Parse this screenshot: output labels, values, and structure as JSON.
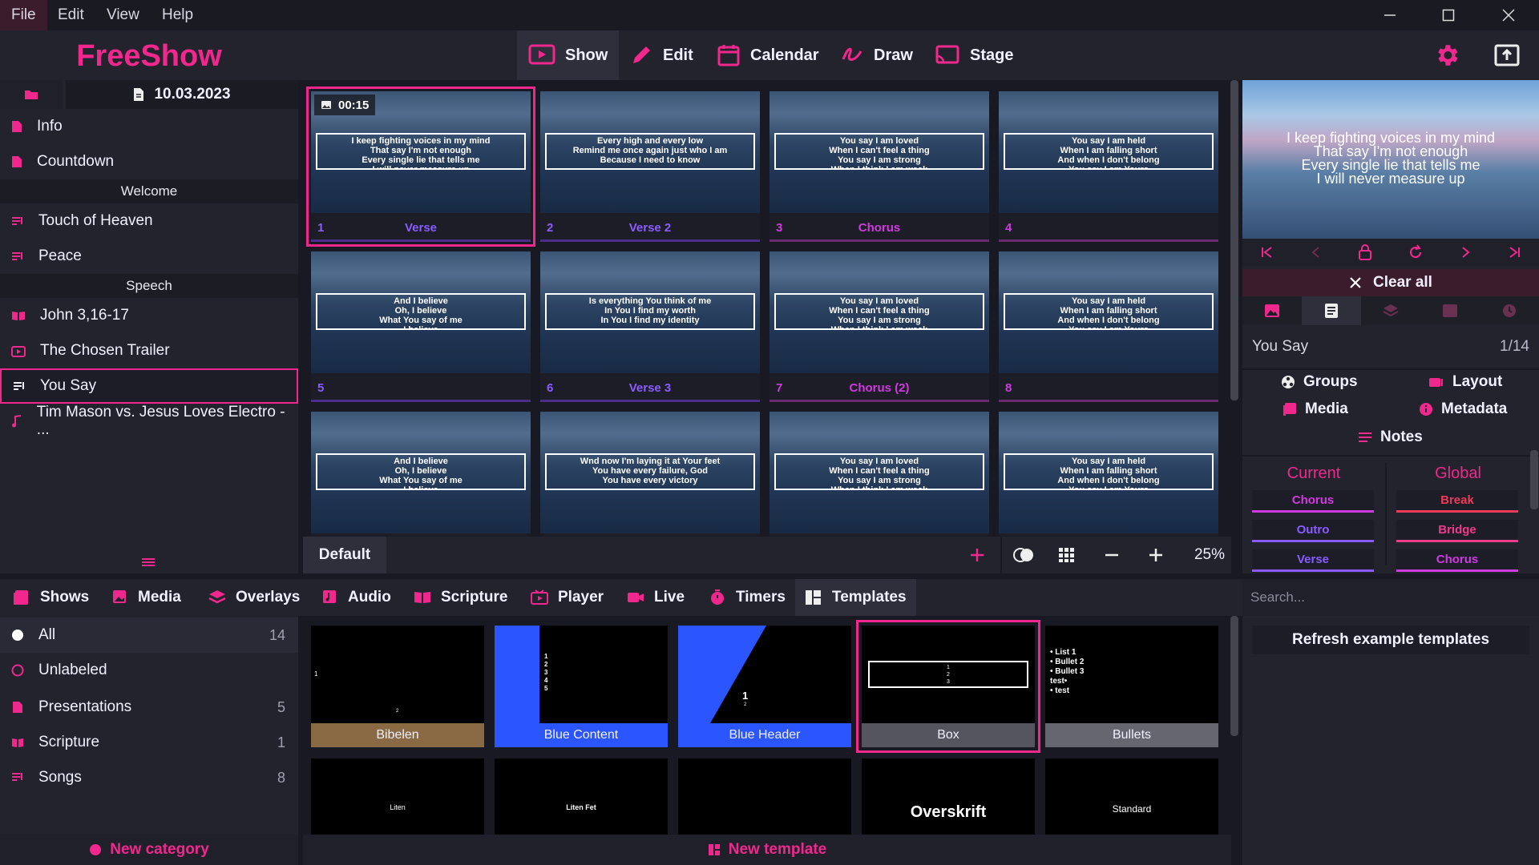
{
  "menu": [
    "File",
    "Edit",
    "View",
    "Help"
  ],
  "app_title": "FreeShow",
  "nav_tabs": [
    "Show",
    "Edit",
    "Calendar",
    "Draw",
    "Stage"
  ],
  "project": {
    "date": "10.03.2023"
  },
  "project_items": [
    {
      "label": "Info",
      "icon": "presentation-icon"
    },
    {
      "label": "Countdown",
      "icon": "presentation-icon"
    },
    {
      "section": "Welcome"
    },
    {
      "label": "Touch of Heaven",
      "icon": "song-icon"
    },
    {
      "label": "Peace",
      "icon": "song-icon"
    },
    {
      "section": "Speech"
    },
    {
      "label": "John 3,16-17",
      "icon": "scripture-icon"
    },
    {
      "label": "The Chosen Trailer",
      "icon": "video-icon"
    },
    {
      "label": "You Say",
      "icon": "song-icon",
      "active": true
    },
    {
      "label": "Tim Mason vs. Jesus Loves Electro - ...",
      "icon": "music-icon"
    }
  ],
  "slides": [
    {
      "num": "1",
      "name": "Verse",
      "color": "#8a5cff",
      "timer": "00:15",
      "lines": [
        "I keep fighting voices in my mind",
        "That say I'm not enough",
        "Every single lie that tells me",
        "I will never measure up"
      ]
    },
    {
      "num": "2",
      "name": "Verse 2",
      "color": "#8a5cff",
      "lines": [
        "Every high and every low",
        "Remind me once again just who I am",
        "Because I need to know"
      ]
    },
    {
      "num": "3",
      "name": "Chorus",
      "color": "#d03ae0",
      "lines": [
        "You say I am loved",
        "When I can't feel a thing",
        "You say I am strong",
        "When I think I am weak"
      ]
    },
    {
      "num": "4",
      "name": "",
      "color": "#d03ae0",
      "lines": [
        "You say I am held",
        "When I am falling short",
        "And when I don't belong",
        "You say I am Yours"
      ]
    },
    {
      "num": "5",
      "name": "",
      "color": "#8a5cff",
      "lines": [
        "And I believe",
        "Oh, I believe",
        "What You say of me",
        "I believe"
      ]
    },
    {
      "num": "6",
      "name": "Verse 3",
      "color": "#8a5cff",
      "lines": [
        "Is everything You think of me",
        "In You I find my worth",
        "In You I find my identity"
      ]
    },
    {
      "num": "7",
      "name": "Chorus (2)",
      "color": "#d03ae0",
      "lines": [
        "You say I am loved",
        "When I can't feel a thing",
        "You say I am strong",
        "When I think I am weak"
      ]
    },
    {
      "num": "8",
      "name": "",
      "color": "#d03ae0",
      "lines": [
        "You say I am held",
        "When I am falling short",
        "And when I don't belong",
        "You say I am Yours"
      ]
    },
    {
      "num": "",
      "name": "",
      "color": "#8a5cff",
      "lines": [
        "And I believe",
        "Oh, I believe",
        "What You say of me",
        "I believe"
      ]
    },
    {
      "num": "",
      "name": "",
      "color": "#8a5cff",
      "lines": [
        "Wnd now I'm laying it at Your feet",
        "You have every failure, God",
        "You have every victory"
      ]
    },
    {
      "num": "",
      "name": "",
      "color": "#d03ae0",
      "lines": [
        "You say I am loved",
        "When I can't feel a thing",
        "You say I am strong",
        "When I think I am weak"
      ]
    },
    {
      "num": "",
      "name": "",
      "color": "#d03ae0",
      "lines": [
        "You say I am held",
        "When I am falling short",
        "And when I don't belong",
        "You say I am Yours"
      ]
    }
  ],
  "slide_toolbar": {
    "layout_name": "Default",
    "zoom": "25%"
  },
  "preview": {
    "text_lines": [
      "I keep fighting voices in my mind",
      "That say I'm not enough",
      "Every single lie that tells me",
      "I will never measure up"
    ]
  },
  "clear_all": "Clear all",
  "show_info": {
    "title": "You Say",
    "position": "1/14"
  },
  "show_options": [
    "Groups",
    "Layout",
    "Media",
    "Metadata",
    "Notes"
  ],
  "groups": {
    "current_label": "Current",
    "global_label": "Global",
    "current": [
      {
        "name": "Chorus",
        "color": "#d03ae0"
      },
      {
        "name": "Outro",
        "color": "#8a5cff"
      },
      {
        "name": "Verse",
        "color": "#8a5cff"
      }
    ],
    "global": [
      {
        "name": "Break",
        "color": "#f03a5a"
      },
      {
        "name": "Bridge",
        "color": "#f03a8a"
      },
      {
        "name": "Chorus",
        "color": "#d03ae0"
      }
    ]
  },
  "bottom_tabs": [
    "Shows",
    "Media",
    "Overlays",
    "Audio",
    "Scripture",
    "Player",
    "Live",
    "Timers",
    "Templates"
  ],
  "categories": [
    {
      "label": "All",
      "count": "14"
    },
    {
      "label": "Unlabeled",
      "count": ""
    },
    {
      "label": "Presentations",
      "count": "5"
    },
    {
      "label": "Scripture",
      "count": "1"
    },
    {
      "label": "Songs",
      "count": "8"
    }
  ],
  "new_category": "New category",
  "templates": [
    {
      "name": "Bibelen",
      "caption_color": "#8a6a44"
    },
    {
      "name": "Blue Content",
      "caption_color": "#2a55ff"
    },
    {
      "name": "Blue Header",
      "caption_color": "#2a55ff"
    },
    {
      "name": "Box",
      "caption_color": "#555560"
    },
    {
      "name": "Bullets",
      "caption_color": "#666670"
    },
    {
      "name": "Liten",
      "caption_color": ""
    },
    {
      "name": "Liten Fet",
      "caption_color": ""
    },
    {
      "name": "",
      "caption_color": ""
    },
    {
      "name": "Overskrift",
      "caption_color": ""
    },
    {
      "name": "Standard",
      "caption_color": ""
    }
  ],
  "template_previews": {
    "bibelen_marks": [
      "1",
      "2"
    ],
    "blue_content_marks": [
      "1",
      "2",
      "3",
      "4",
      "5"
    ],
    "blue_header_marks": [
      "1",
      "2"
    ],
    "box_marks": [
      "1",
      "2",
      "3"
    ],
    "bullets_lines": [
      "• List 1",
      "• Bullet 2",
      "• Bullet 3",
      "test•",
      "• test"
    ]
  },
  "new_template": "New template",
  "search": {
    "placeholder": "Search..."
  },
  "refresh_button": "Refresh example templates",
  "colors": {
    "accent": "#f0288e",
    "verse": "#8a5cff",
    "chorus": "#d03ae0"
  }
}
